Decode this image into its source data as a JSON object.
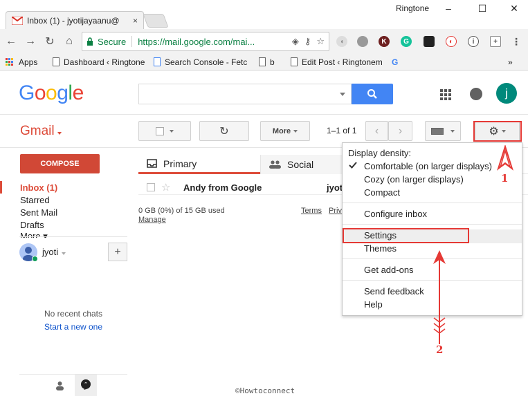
{
  "browser": {
    "tab_title": "Inbox (1) - jyotijayaanu@",
    "tab_close": "×",
    "profile": "Ringtone",
    "controls": {
      "minimize": "–",
      "maximize": "☐",
      "close": "✕"
    },
    "secure_label": "Secure",
    "url": "https://mail.google.com/mai...",
    "bookmarks": [
      {
        "label": "Apps"
      },
      {
        "label": "Dashboard ‹ Ringtone"
      },
      {
        "label": "Search Console - Fetc"
      },
      {
        "label": "b"
      },
      {
        "label": "Edit Post ‹ Ringtonem"
      }
    ],
    "bookmarks_more": "»"
  },
  "gmail": {
    "logo": "Google",
    "avatar_letter": "j",
    "app_label": "Gmail",
    "more_label": "More",
    "page_info": "1–1 of 1",
    "compose": "COMPOSE",
    "nav": [
      {
        "label": "Inbox (1)",
        "active": true
      },
      {
        "label": "Starred"
      },
      {
        "label": "Sent Mail"
      },
      {
        "label": "Drafts"
      },
      {
        "label": "More ▾"
      }
    ],
    "chat_user": "jyoti",
    "no_chats": "No recent chats",
    "start_new": "Start a new one",
    "tabs": {
      "primary": "Primary",
      "social": "Social"
    },
    "email": {
      "from": "Andy from Google",
      "subject": "jyot"
    },
    "storage": "0 GB (0%) of 15 GB used",
    "manage": "Manage",
    "terms": "Terms",
    "privacy": "Priv"
  },
  "menu": {
    "density_header": "Display density:",
    "comfortable": "Comfortable (on larger displays)",
    "cozy": "Cozy (on larger displays)",
    "compact": "Compact",
    "configure_inbox": "Configure inbox",
    "settings": "Settings",
    "themes": "Themes",
    "get_addons": "Get add-ons",
    "send_feedback": "Send feedback",
    "help": "Help"
  },
  "annotations": {
    "step1": "1",
    "step2": "2"
  },
  "watermark": "©Howtoconnect",
  "colors": {
    "accent_red": "#e53935",
    "gmail_red": "#dd4b39",
    "google_blue": "#4285f4",
    "secure_green": "#0b8043"
  }
}
